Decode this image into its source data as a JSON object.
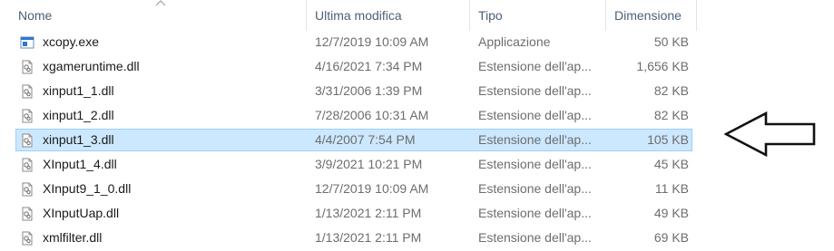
{
  "columns": {
    "name": "Nome",
    "modified": "Ultima modifica",
    "type": "Tipo",
    "size": "Dimensione"
  },
  "files": [
    {
      "name": "xcopy.exe",
      "modified": "12/7/2019 10:09 AM",
      "type": "Applicazione",
      "size": "50 KB",
      "icon": "application-icon",
      "selected": false
    },
    {
      "name": "xgameruntime.dll",
      "modified": "4/16/2021 7:34 PM",
      "type": "Estensione dell'ap...",
      "size": "1,656 KB",
      "icon": "dll-file-icon",
      "selected": false
    },
    {
      "name": "xinput1_1.dll",
      "modified": "3/31/2006 1:39 PM",
      "type": "Estensione dell'ap...",
      "size": "82 KB",
      "icon": "dll-file-icon",
      "selected": false
    },
    {
      "name": "xinput1_2.dll",
      "modified": "7/28/2006 10:31 AM",
      "type": "Estensione dell'ap...",
      "size": "82 KB",
      "icon": "dll-file-icon",
      "selected": false
    },
    {
      "name": "xinput1_3.dll",
      "modified": "4/4/2007 7:54 PM",
      "type": "Estensione dell'ap...",
      "size": "105 KB",
      "icon": "dll-file-icon",
      "selected": true
    },
    {
      "name": "XInput1_4.dll",
      "modified": "3/9/2021 10:21 PM",
      "type": "Estensione dell'ap...",
      "size": "45 KB",
      "icon": "dll-file-icon",
      "selected": false
    },
    {
      "name": "XInput9_1_0.dll",
      "modified": "12/7/2019 10:09 AM",
      "type": "Estensione dell'ap...",
      "size": "11 KB",
      "icon": "dll-file-icon",
      "selected": false
    },
    {
      "name": "XInputUap.dll",
      "modified": "1/13/2021 2:11 PM",
      "type": "Estensione dell'ap...",
      "size": "49 KB",
      "icon": "dll-file-icon",
      "selected": false
    },
    {
      "name": "xmlfilter.dll",
      "modified": "1/13/2021 2:11 PM",
      "type": "Estensione dell'ap...",
      "size": "69 KB",
      "icon": "dll-file-icon",
      "selected": false
    }
  ],
  "colors": {
    "selection_bg": "#cce8ff",
    "selection_border": "#99d1ff",
    "header_text": "#4c607a",
    "secondary_text": "#6d6d6d"
  }
}
